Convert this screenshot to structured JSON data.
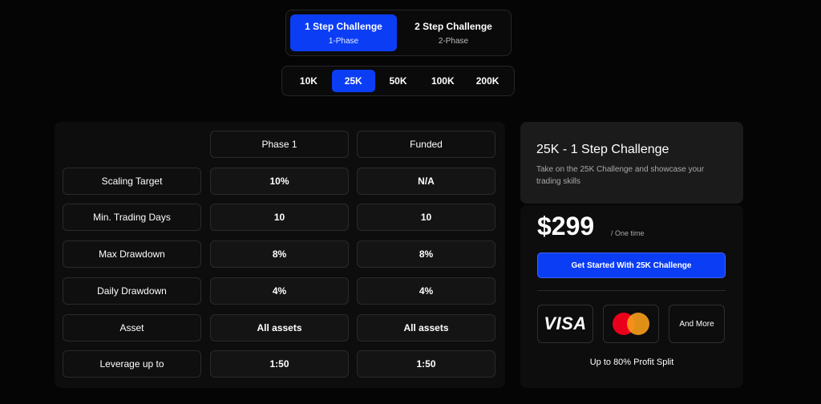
{
  "challenge_tabs": [
    {
      "title": "1 Step Challenge",
      "subtitle": "1-Phase"
    },
    {
      "title": "2 Step Challenge",
      "subtitle": "2-Phase"
    }
  ],
  "size_tabs": [
    "10K",
    "25K",
    "50K",
    "100K",
    "200K"
  ],
  "table": {
    "columns": [
      "Phase 1",
      "Funded"
    ],
    "rows": [
      {
        "label": "Scaling Target",
        "phase1": "10%",
        "funded": "N/A"
      },
      {
        "label": "Min. Trading Days",
        "phase1": "10",
        "funded": "10"
      },
      {
        "label": "Max Drawdown",
        "phase1": "8%",
        "funded": "8%"
      },
      {
        "label": "Daily Drawdown",
        "phase1": "4%",
        "funded": "4%"
      },
      {
        "label": "Asset",
        "phase1": "All assets",
        "funded": "All assets"
      },
      {
        "label": "Leverage up to",
        "phase1": "1:50",
        "funded": "1:50"
      }
    ]
  },
  "card": {
    "title": "25K - 1 Step Challenge",
    "description": "Take on the 25K Challenge and showcase your trading skills",
    "price": "$299",
    "price_note": "/ One time",
    "cta": "Get Started With 25K Challenge",
    "payments": {
      "visa": "VISA",
      "more": "And More"
    },
    "profit_split": "Up to 80% Profit Split"
  },
  "colors": {
    "accent": "#0b3df5",
    "background": "#050505"
  }
}
